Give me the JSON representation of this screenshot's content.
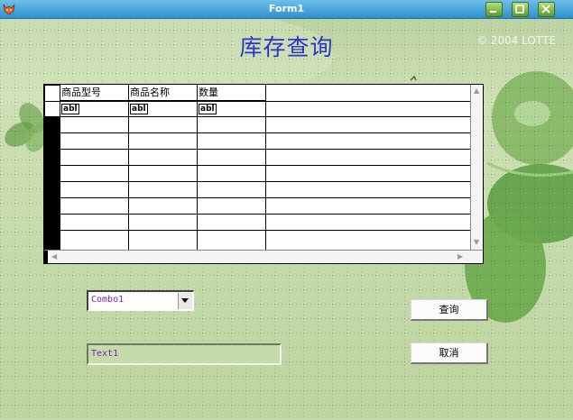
{
  "window": {
    "title": "Form1",
    "icon": "fox-app-icon",
    "controls": [
      "minimize-icon",
      "maximize-icon",
      "close-icon"
    ]
  },
  "form": {
    "heading": "库存查询",
    "copyright": "© 2004 LOTTE"
  },
  "grid": {
    "columns": [
      "商品型号",
      "商品名称",
      "数量"
    ],
    "cell_glyph": "abl",
    "visible_rows": 9
  },
  "combo": {
    "value": "Combo1"
  },
  "textbox": {
    "value": "Text1"
  },
  "buttons": {
    "query": "查询",
    "cancel": "取消"
  },
  "colors": {
    "heading": "#2a36c8",
    "control_text": "#7a22a8",
    "titlebar": "#2f8fcf"
  }
}
